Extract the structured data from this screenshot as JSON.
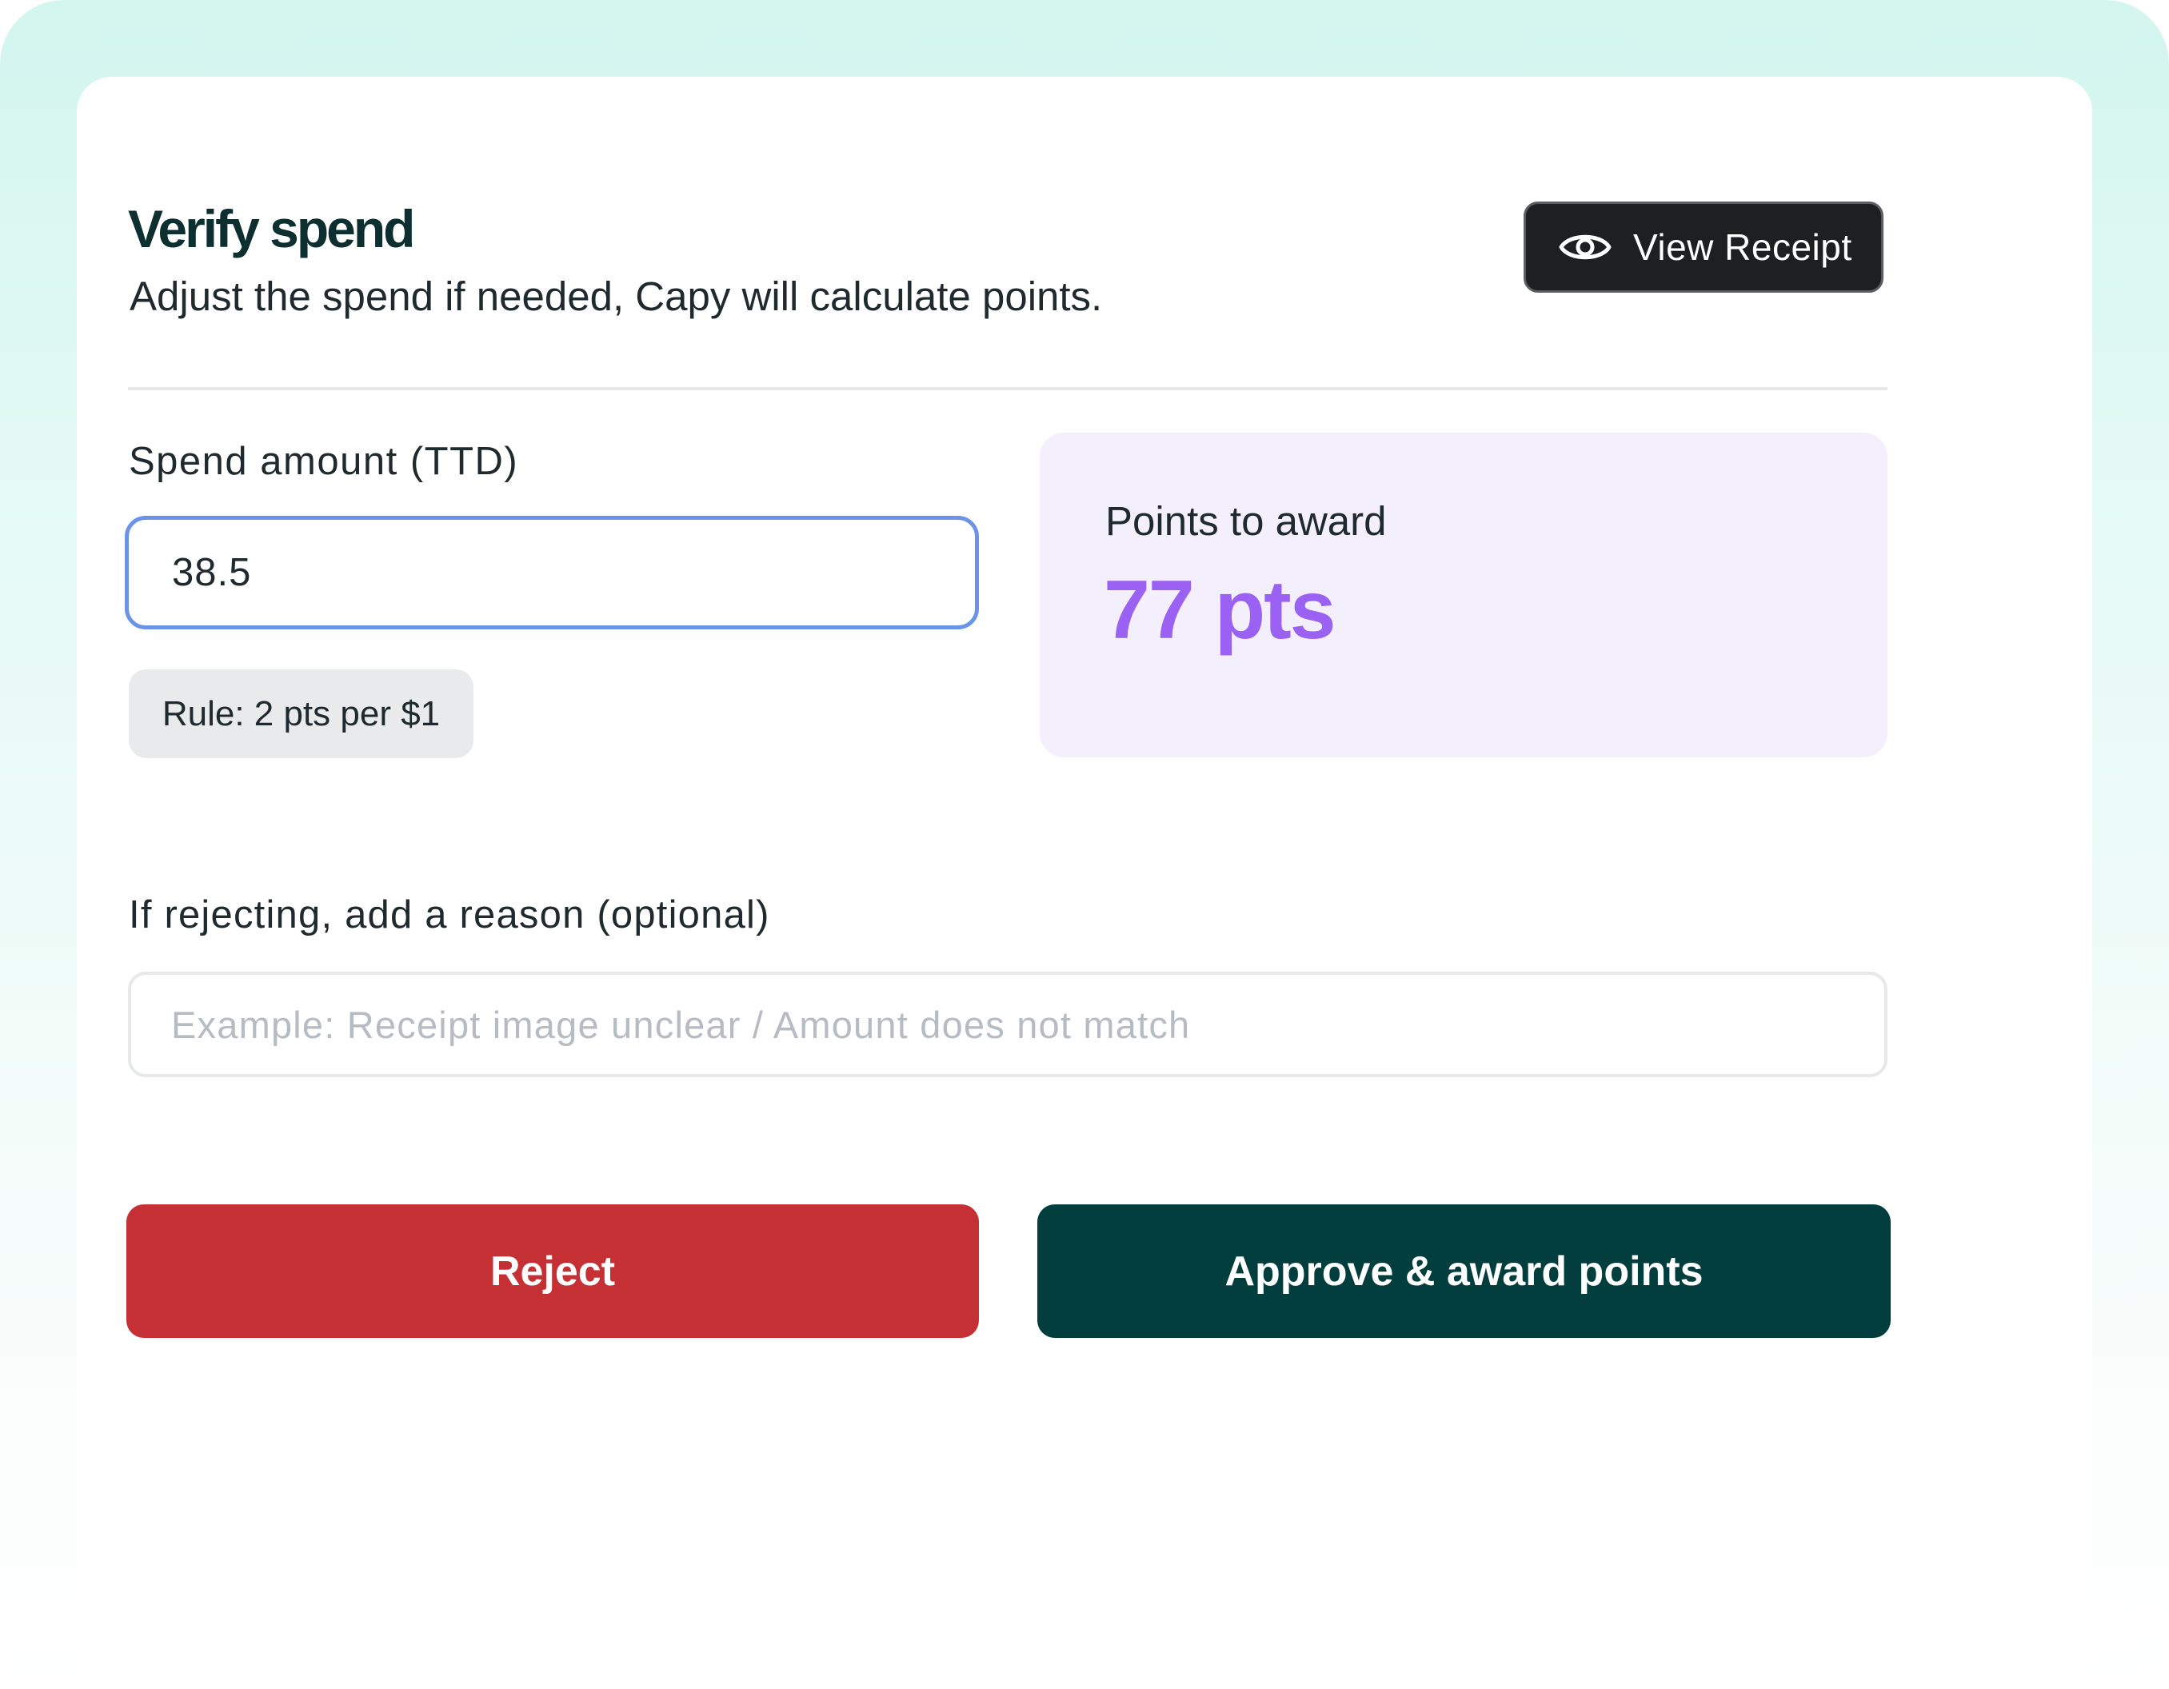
{
  "header": {
    "title": "Verify spend",
    "subtitle": "Adjust the spend if needed, Capy will calculate points.",
    "view_receipt_label": "View Receipt",
    "view_receipt_icon": "eye-icon"
  },
  "spend": {
    "label": "Spend amount (TTD)",
    "value": "38.5",
    "rule": "Rule: 2 pts per $1"
  },
  "points": {
    "label": "Points to award",
    "value": "77 pts"
  },
  "reason": {
    "label": "If rejecting, add a reason (optional)",
    "placeholder": "Example: Receipt image unclear / Amount does not match",
    "value": ""
  },
  "actions": {
    "reject_label": "Reject",
    "approve_label": "Approve & award points"
  },
  "colors": {
    "accent_points": "#9b61f2",
    "reject": "#c43033",
    "approve": "#033e3e",
    "input_focus": "#6b93ea"
  }
}
